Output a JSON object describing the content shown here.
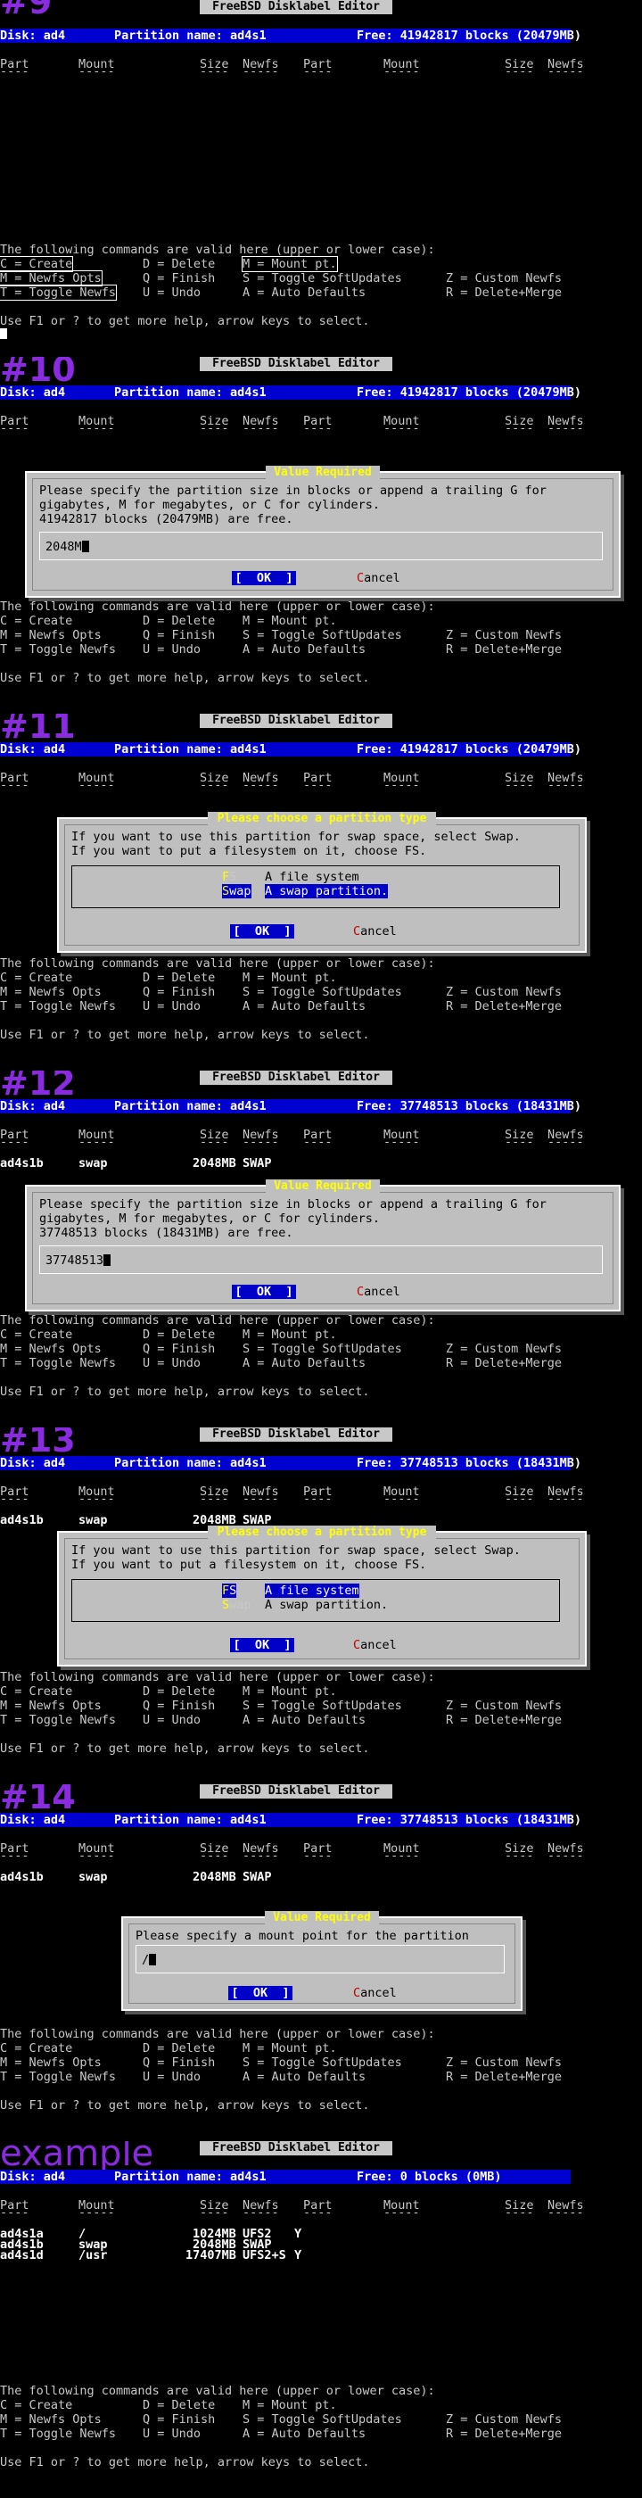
{
  "app_title": "FreeBSD Disklabel Editor",
  "column_headers": {
    "part": "Part",
    "mount": "Mount",
    "size": "Size",
    "newfs": "Newfs"
  },
  "commands": {
    "header": "The following commands are valid here (upper or lower case):",
    "row1": [
      "C = Create",
      "D = Delete",
      "M = Mount pt."
    ],
    "row2": [
      "M = Newfs Opts",
      "Q = Finish",
      "S = Toggle SoftUpdates",
      "Z = Custom Newfs"
    ],
    "row3": [
      "T = Toggle Newfs",
      "U = Undo",
      "A = Auto Defaults",
      "R = Delete+Merge"
    ],
    "help": "Use F1 or ? to get more help, arrow keys to select."
  },
  "panels": [
    {
      "step": "#9",
      "disk_line": {
        "disk": "Disk: ad4",
        "partition": "Partition name: ad4s1",
        "free": "Free: 41942817 blocks (20479MB)"
      },
      "rows": []
    },
    {
      "step": "#10",
      "disk_line": {
        "disk": "Disk: ad4",
        "partition": "Partition name: ad4s1",
        "free": "Free: 41942817 blocks (20479MB)"
      },
      "rows": [],
      "dialog": {
        "title": " Value Required ",
        "lines": [
          "Please specify the partition size in blocks or append a trailing G for",
          "gigabytes, M for megabytes, or C for cylinders.",
          "41942817 blocks (20479MB) are free."
        ],
        "input": "2048M",
        "ok": "[  OK  ]",
        "cancel_hot": "C",
        "cancel_rest": "ancel"
      }
    },
    {
      "step": "#11",
      "disk_line": {
        "disk": "Disk: ad4",
        "partition": "Partition name: ad4s1",
        "free": "Free: 41942817 blocks (20479MB)"
      },
      "rows": [],
      "dialog": {
        "title": " Please choose a partition type ",
        "lines": [
          "If you want to use this partition for swap space, select Swap.",
          "If you want to put a filesystem on it, choose FS."
        ],
        "options": [
          {
            "key": "FS",
            "label": "A file system"
          },
          {
            "key": "Swap",
            "label": "A swap partition."
          }
        ],
        "selected": 1,
        "ok": "[  OK  ]",
        "cancel_hot": "C",
        "cancel_rest": "ancel"
      }
    },
    {
      "step": "#12",
      "disk_line": {
        "disk": "Disk: ad4",
        "partition": "Partition name: ad4s1",
        "free": "Free: 37748513 blocks (18431MB)"
      },
      "rows": [
        {
          "part": "ad4s1b",
          "mount": "swap",
          "size": "2048MB",
          "newfs": "SWAP",
          "flag": ""
        }
      ],
      "dialog": {
        "title": " Value Required ",
        "lines": [
          "Please specify the partition size in blocks or append a trailing G for",
          "gigabytes, M for megabytes, or C for cylinders.",
          "37748513 blocks (18431MB) are free."
        ],
        "input": "37748513",
        "ok": "[  OK  ]",
        "cancel_hot": "C",
        "cancel_rest": "ancel"
      }
    },
    {
      "step": "#13",
      "disk_line": {
        "disk": "Disk: ad4",
        "partition": "Partition name: ad4s1",
        "free": "Free: 37748513 blocks (18431MB)"
      },
      "rows": [
        {
          "part": "ad4s1b",
          "mount": "swap",
          "size": "2048MB",
          "newfs": "SWAP",
          "flag": ""
        }
      ],
      "dialog": {
        "title": " Please choose a partition type ",
        "lines": [
          "If you want to use this partition for swap space, select Swap.",
          "If you want to put a filesystem on it, choose FS."
        ],
        "options": [
          {
            "key": "FS",
            "label": "A file system"
          },
          {
            "key": "Swap",
            "label": "A swap partition."
          }
        ],
        "selected": 0,
        "ok": "[  OK  ]",
        "cancel_hot": "C",
        "cancel_rest": "ancel"
      }
    },
    {
      "step": "#14",
      "disk_line": {
        "disk": "Disk: ad4",
        "partition": "Partition name: ad4s1",
        "free": "Free: 37748513 blocks (18431MB)"
      },
      "rows": [
        {
          "part": "ad4s1b",
          "mount": "swap",
          "size": "2048MB",
          "newfs": "SWAP",
          "flag": ""
        }
      ],
      "dialog": {
        "title": " Value Required ",
        "lines": [
          "Please specify a mount point for the partition"
        ],
        "input": "/",
        "ok": "[  OK  ]",
        "cancel_hot": "C",
        "cancel_rest": "ancel"
      }
    },
    {
      "step": "example",
      "disk_line": {
        "disk": "Disk: ad4",
        "partition": "Partition name: ad4s1",
        "free": "Free: 0 blocks (0MB)"
      },
      "rows": [
        {
          "part": "ad4s1a",
          "mount": "/",
          "size": "1024MB",
          "newfs": "UFS2",
          "flag": "Y"
        },
        {
          "part": "ad4s1b",
          "mount": "swap",
          "size": "2048MB",
          "newfs": "SWAP",
          "flag": ""
        },
        {
          "part": "ad4s1d",
          "mount": "/usr",
          "size": "17407MB",
          "newfs": "UFS2+S",
          "flag": "Y"
        }
      ]
    }
  ]
}
